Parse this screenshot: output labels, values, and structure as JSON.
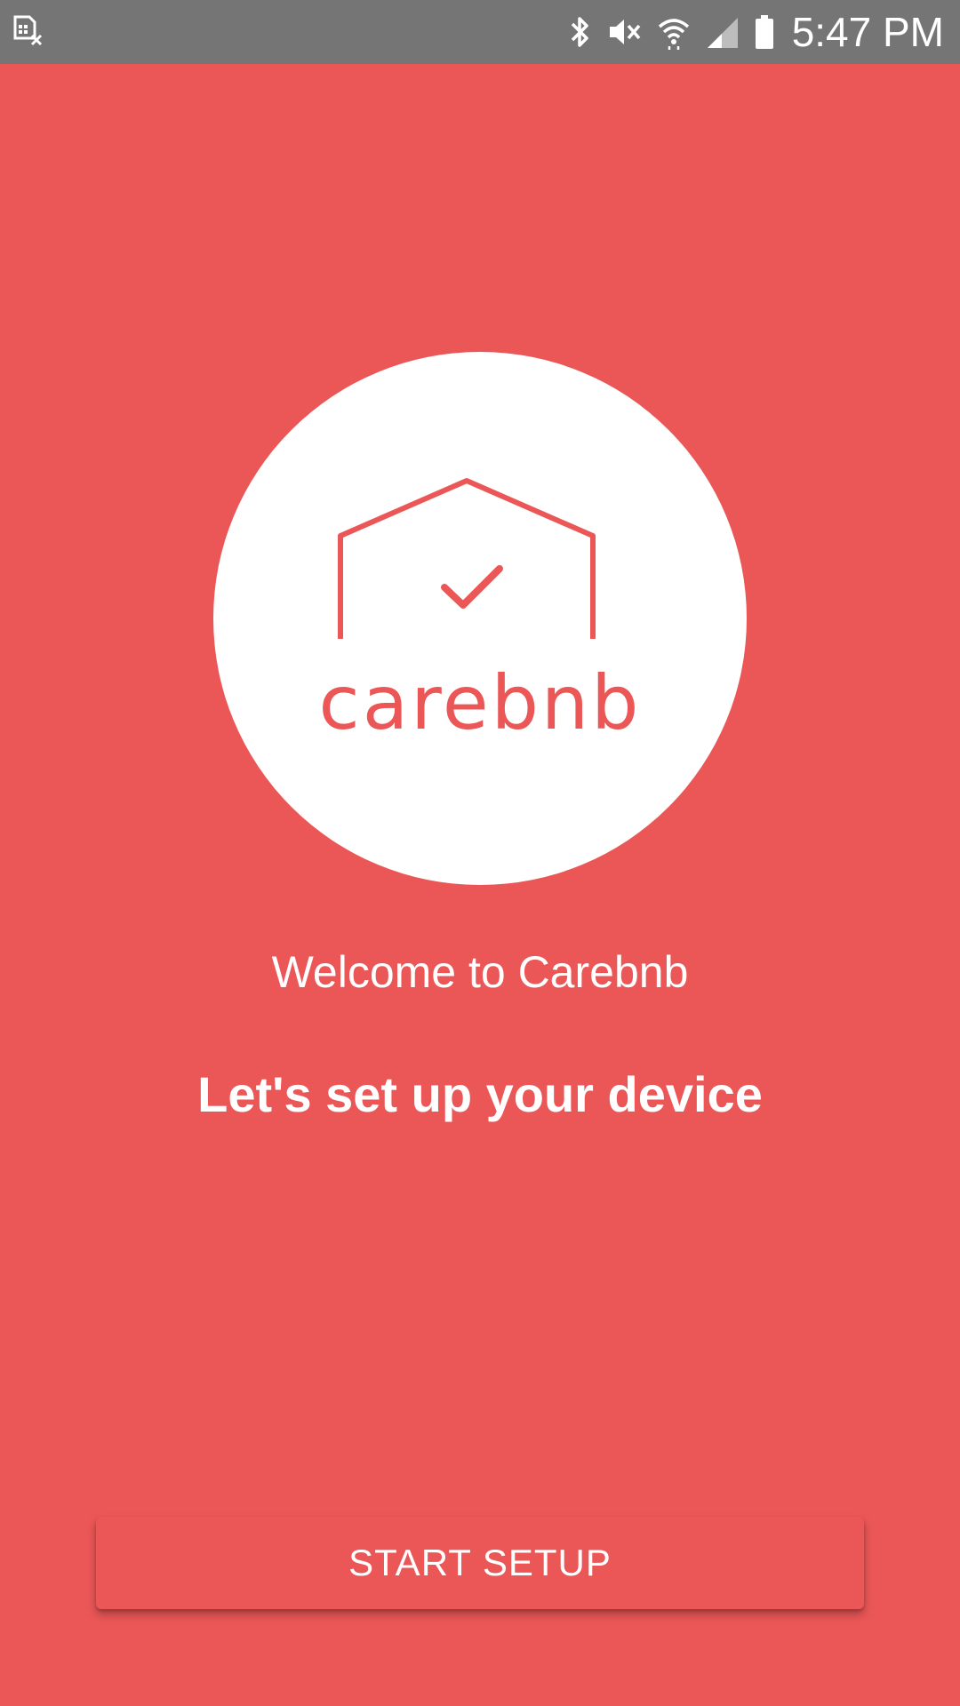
{
  "status_bar": {
    "time": "5:47 PM",
    "icons": [
      "sim-error-icon",
      "bluetooth-icon",
      "mute-icon",
      "wifi-icon",
      "signal-icon",
      "battery-icon"
    ]
  },
  "logo": {
    "text": "carebnb",
    "icon": "house-check-icon"
  },
  "welcome_text": "Welcome to Carebnb",
  "headline": "Let's set up your device",
  "start_button": {
    "label": "START SETUP"
  },
  "colors": {
    "background": "#EB5757",
    "status_bar": "#757575",
    "logo_circle": "#FFFFFF",
    "text": "#FFFFFF"
  }
}
